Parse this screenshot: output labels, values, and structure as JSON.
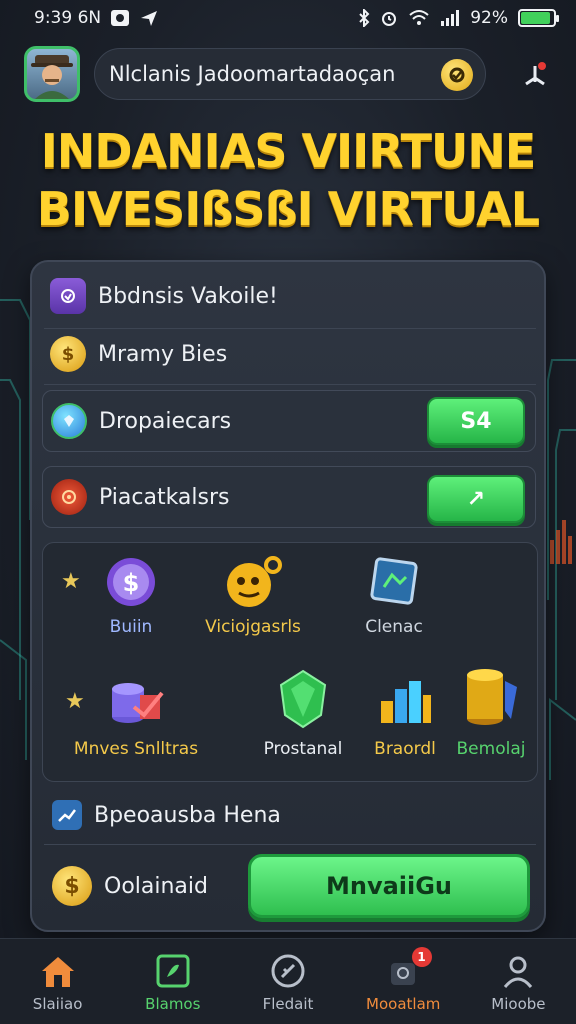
{
  "status_bar": {
    "time": "9:39 6N",
    "battery_text": "92%"
  },
  "header": {
    "search_text": "Nlclanis Jadoomartadaoçan",
    "avatar_icon": "avatar-icon",
    "coin_icon": "coin-icon",
    "menu_icon": "share-icon"
  },
  "title": {
    "line1": "INDANIAS VIIRTUNE",
    "line2": "BIVESIßSßI VIRTUAL"
  },
  "panel": {
    "rows": [
      {
        "label": "Bbdnsis Vakoile!",
        "icon": "shield-icon"
      },
      {
        "label": "Mramy Bies",
        "icon": "coin-icon"
      },
      {
        "label": "Dropaiecars",
        "icon": "gem-icon",
        "button": "S4"
      },
      {
        "label": "Piacatkalsrs",
        "icon": "target-icon",
        "button": "↗"
      }
    ],
    "grid": [
      {
        "label": "Buiin",
        "icon": "dollar-coin-icon",
        "color": "#9fb8ff"
      },
      {
        "label": "Viciojgasrls",
        "icon": "emoji-icon",
        "color": "#f4c94a"
      },
      {
        "label": "Clenac",
        "icon": "frame-icon",
        "color": "#cfd6df"
      },
      {
        "label": "Mnves Snlltras",
        "icon": "coin-stack-icon",
        "color": "#f4c94a"
      },
      {
        "label": "Prostanal",
        "icon": "green-shield-icon",
        "color": "#e8ecf2"
      },
      {
        "label": "Braordl",
        "icon": "bar-chart-icon",
        "color": "#f4c94a"
      },
      {
        "label": "Bemolaj",
        "icon": "gold-stack-icon",
        "color": "#57d36e"
      }
    ],
    "footer_row": {
      "label": "Bpeoausba Hena",
      "icon": "trend-icon"
    },
    "bottom_row": {
      "label": "Oolainaid",
      "icon": "coin-icon"
    },
    "cta_label": "MnvaiiGu"
  },
  "nav": {
    "items": [
      {
        "label": "Slaiiao",
        "icon": "home-icon",
        "color": "#b8bfca"
      },
      {
        "label": "Blamos",
        "icon": "games-icon",
        "color": "#57d36e"
      },
      {
        "label": "Fledait",
        "icon": "slash-circle-icon",
        "color": "#b8bfca"
      },
      {
        "label": "Mooatlam",
        "icon": "bag-icon",
        "color": "#f08c3c",
        "badge": "1"
      },
      {
        "label": "Mioobe",
        "icon": "user-icon",
        "color": "#b8bfca"
      }
    ]
  },
  "colors": {
    "accent_green": "#2fbf4f",
    "title_gold": "#ffd22e",
    "background": "#1b2029"
  }
}
